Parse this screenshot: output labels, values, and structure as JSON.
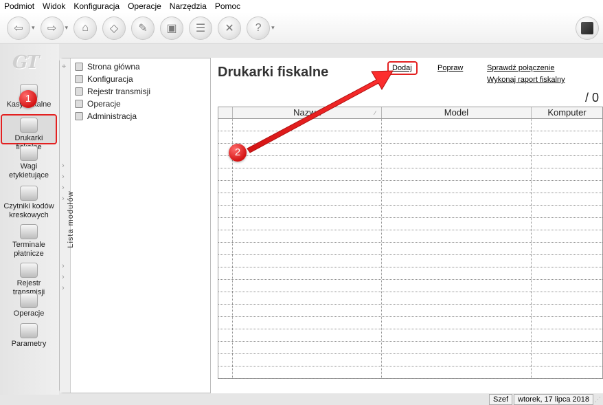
{
  "menu": [
    "Podmiot",
    "Widok",
    "Konfiguracja",
    "Operacje",
    "Narzędzia",
    "Pomoc"
  ],
  "logo": "GT",
  "sidebar": {
    "modules": [
      {
        "label": "Kasy fiskalne",
        "icon": "cash-register-icon"
      },
      {
        "label": "Drukarki fiskalne",
        "icon": "fiscal-printer-icon"
      },
      {
        "label": "Wagi etykietujące",
        "icon": "scale-icon"
      },
      {
        "label": "Czytniki kodów kreskowych",
        "icon": "barcode-scanner-icon"
      },
      {
        "label": "Terminale płatnicze",
        "icon": "payment-terminal-icon"
      },
      {
        "label": "Rejestr transmisji",
        "icon": "transmission-register-icon"
      },
      {
        "label": "Operacje",
        "icon": "gears-icon"
      },
      {
        "label": "Parametry",
        "icon": "parameters-icon"
      }
    ]
  },
  "module_panel": {
    "vertical_label": "Lista modułów",
    "items": [
      {
        "label": "Strona główna",
        "icon": "home-icon"
      },
      {
        "label": "Konfiguracja",
        "icon": "wrench-icon"
      },
      {
        "label": "Rejestr transmisji",
        "icon": "register-icon"
      },
      {
        "label": "Operacje",
        "icon": "gear-icon"
      },
      {
        "label": "Administracja",
        "icon": "admin-icon"
      }
    ]
  },
  "main": {
    "title": "Drukarki fiskalne",
    "links": {
      "add": "Dodaj",
      "edit": "Popraw",
      "check_connection": "Sprawdź połączenie",
      "fiscal_report": "Wykonaj raport fiskalny"
    },
    "count": "/ 0",
    "columns": [
      "Nazwa",
      "Model",
      "Komputer"
    ]
  },
  "annotations": {
    "step1": "1",
    "step2": "2"
  },
  "status": {
    "user": "Szef",
    "date": "wtorek, 17 lipca 2018"
  },
  "colors": {
    "annotation_red": "#e32020",
    "accent_gray": "#e6e6e6"
  }
}
